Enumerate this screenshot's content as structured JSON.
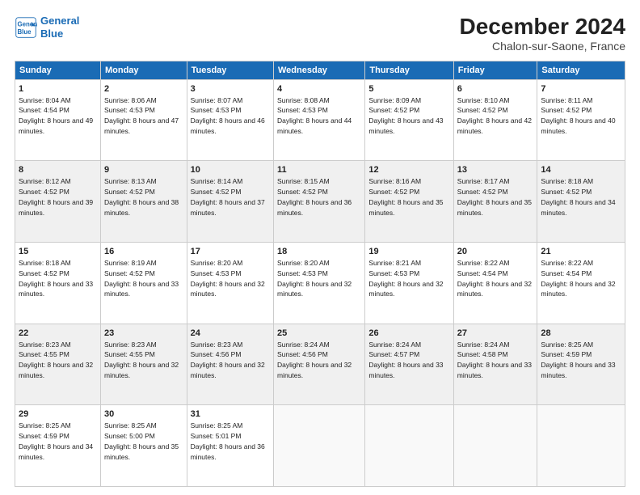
{
  "logo": {
    "line1": "General",
    "line2": "Blue"
  },
  "title": "December 2024",
  "subtitle": "Chalon-sur-Saone, France",
  "days_of_week": [
    "Sunday",
    "Monday",
    "Tuesday",
    "Wednesday",
    "Thursday",
    "Friday",
    "Saturday"
  ],
  "weeks": [
    [
      {
        "day": 1,
        "sunrise": "8:04 AM",
        "sunset": "4:54 PM",
        "daylight": "8 hours and 49 minutes."
      },
      {
        "day": 2,
        "sunrise": "8:06 AM",
        "sunset": "4:53 PM",
        "daylight": "8 hours and 47 minutes."
      },
      {
        "day": 3,
        "sunrise": "8:07 AM",
        "sunset": "4:53 PM",
        "daylight": "8 hours and 46 minutes."
      },
      {
        "day": 4,
        "sunrise": "8:08 AM",
        "sunset": "4:53 PM",
        "daylight": "8 hours and 44 minutes."
      },
      {
        "day": 5,
        "sunrise": "8:09 AM",
        "sunset": "4:52 PM",
        "daylight": "8 hours and 43 minutes."
      },
      {
        "day": 6,
        "sunrise": "8:10 AM",
        "sunset": "4:52 PM",
        "daylight": "8 hours and 42 minutes."
      },
      {
        "day": 7,
        "sunrise": "8:11 AM",
        "sunset": "4:52 PM",
        "daylight": "8 hours and 40 minutes."
      }
    ],
    [
      {
        "day": 8,
        "sunrise": "8:12 AM",
        "sunset": "4:52 PM",
        "daylight": "8 hours and 39 minutes."
      },
      {
        "day": 9,
        "sunrise": "8:13 AM",
        "sunset": "4:52 PM",
        "daylight": "8 hours and 38 minutes."
      },
      {
        "day": 10,
        "sunrise": "8:14 AM",
        "sunset": "4:52 PM",
        "daylight": "8 hours and 37 minutes."
      },
      {
        "day": 11,
        "sunrise": "8:15 AM",
        "sunset": "4:52 PM",
        "daylight": "8 hours and 36 minutes."
      },
      {
        "day": 12,
        "sunrise": "8:16 AM",
        "sunset": "4:52 PM",
        "daylight": "8 hours and 35 minutes."
      },
      {
        "day": 13,
        "sunrise": "8:17 AM",
        "sunset": "4:52 PM",
        "daylight": "8 hours and 35 minutes."
      },
      {
        "day": 14,
        "sunrise": "8:18 AM",
        "sunset": "4:52 PM",
        "daylight": "8 hours and 34 minutes."
      }
    ],
    [
      {
        "day": 15,
        "sunrise": "8:18 AM",
        "sunset": "4:52 PM",
        "daylight": "8 hours and 33 minutes."
      },
      {
        "day": 16,
        "sunrise": "8:19 AM",
        "sunset": "4:52 PM",
        "daylight": "8 hours and 33 minutes."
      },
      {
        "day": 17,
        "sunrise": "8:20 AM",
        "sunset": "4:53 PM",
        "daylight": "8 hours and 32 minutes."
      },
      {
        "day": 18,
        "sunrise": "8:20 AM",
        "sunset": "4:53 PM",
        "daylight": "8 hours and 32 minutes."
      },
      {
        "day": 19,
        "sunrise": "8:21 AM",
        "sunset": "4:53 PM",
        "daylight": "8 hours and 32 minutes."
      },
      {
        "day": 20,
        "sunrise": "8:22 AM",
        "sunset": "4:54 PM",
        "daylight": "8 hours and 32 minutes."
      },
      {
        "day": 21,
        "sunrise": "8:22 AM",
        "sunset": "4:54 PM",
        "daylight": "8 hours and 32 minutes."
      }
    ],
    [
      {
        "day": 22,
        "sunrise": "8:23 AM",
        "sunset": "4:55 PM",
        "daylight": "8 hours and 32 minutes."
      },
      {
        "day": 23,
        "sunrise": "8:23 AM",
        "sunset": "4:55 PM",
        "daylight": "8 hours and 32 minutes."
      },
      {
        "day": 24,
        "sunrise": "8:23 AM",
        "sunset": "4:56 PM",
        "daylight": "8 hours and 32 minutes."
      },
      {
        "day": 25,
        "sunrise": "8:24 AM",
        "sunset": "4:56 PM",
        "daylight": "8 hours and 32 minutes."
      },
      {
        "day": 26,
        "sunrise": "8:24 AM",
        "sunset": "4:57 PM",
        "daylight": "8 hours and 33 minutes."
      },
      {
        "day": 27,
        "sunrise": "8:24 AM",
        "sunset": "4:58 PM",
        "daylight": "8 hours and 33 minutes."
      },
      {
        "day": 28,
        "sunrise": "8:25 AM",
        "sunset": "4:59 PM",
        "daylight": "8 hours and 33 minutes."
      }
    ],
    [
      {
        "day": 29,
        "sunrise": "8:25 AM",
        "sunset": "4:59 PM",
        "daylight": "8 hours and 34 minutes."
      },
      {
        "day": 30,
        "sunrise": "8:25 AM",
        "sunset": "5:00 PM",
        "daylight": "8 hours and 35 minutes."
      },
      {
        "day": 31,
        "sunrise": "8:25 AM",
        "sunset": "5:01 PM",
        "daylight": "8 hours and 36 minutes."
      },
      null,
      null,
      null,
      null
    ]
  ]
}
